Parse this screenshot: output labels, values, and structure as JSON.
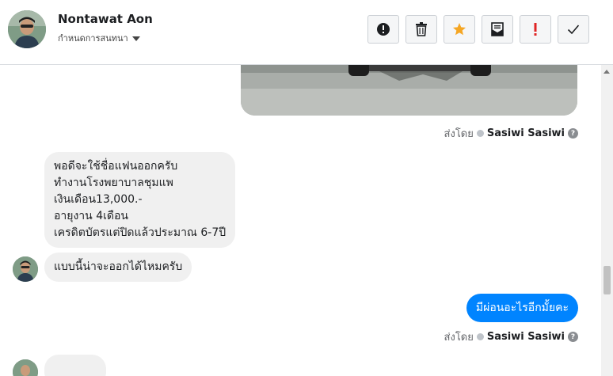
{
  "contact": {
    "name": "Nontawat Aon",
    "subtitle": "กำหนดการสนทนา"
  },
  "toolbar": {
    "buttons": [
      {
        "icon": "alert-circle-icon",
        "color": "#1c1e21"
      },
      {
        "icon": "trash-icon",
        "color": "#1c1e21"
      },
      {
        "icon": "star-icon",
        "color": "#f5a623"
      },
      {
        "icon": "mail-icon",
        "color": "#1c1e21"
      },
      {
        "icon": "exclamation-icon",
        "color": "#e02424"
      },
      {
        "icon": "check-icon",
        "color": "#1c1e21"
      }
    ]
  },
  "messages": {
    "sent_label": "ส่งโดย",
    "sender": "Sasiwi Sasiwi",
    "help": "?",
    "incoming_1_lines": [
      "พอดีจะใช้ชื่อแฟนออกครับ",
      "ทำงานโรงพยาบาลชุมแพ",
      "เงินเดือน13,000.-",
      "อายุงาน 4เดือน",
      "เครดิตบัตรแต่ปิดแล้วประมาณ 6-7ปี"
    ],
    "incoming_2": "แบบนี้น่าจะออกได้ไหมครับ",
    "outgoing_1": "มีผ่อนอะไรอีกมั้ยคะ"
  },
  "colors": {
    "accent": "#0084ff",
    "bubble_in": "#f0f0f0"
  }
}
